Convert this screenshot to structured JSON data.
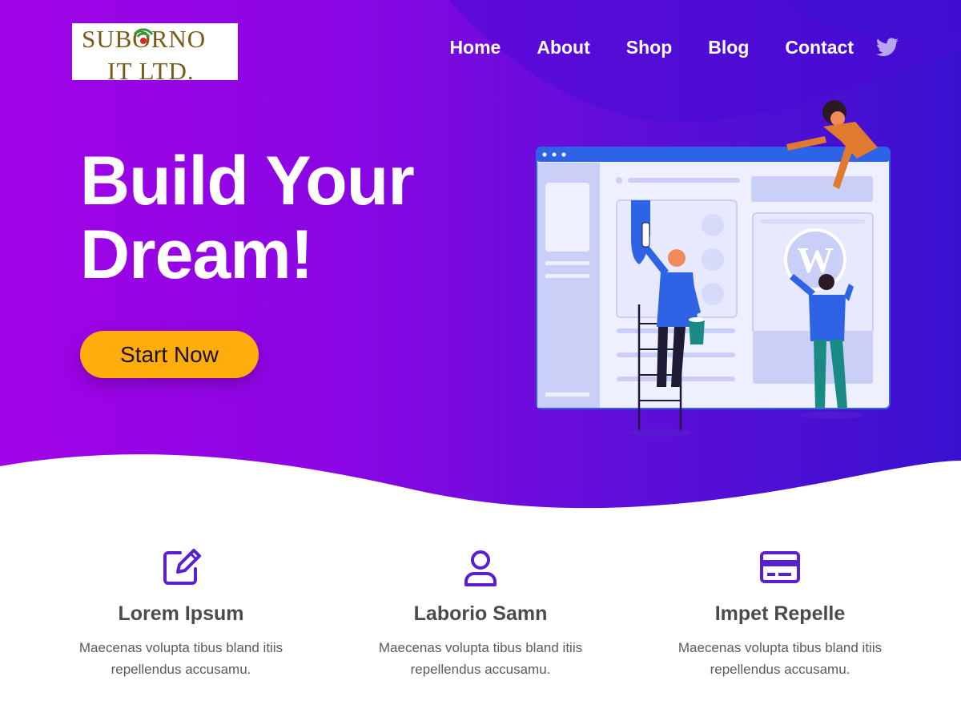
{
  "brand": {
    "logo_line1": "SUBORNO",
    "logo_line2": "IT LTD."
  },
  "nav": {
    "items": [
      {
        "label": "Home"
      },
      {
        "label": "About"
      },
      {
        "label": "Shop"
      },
      {
        "label": "Blog"
      },
      {
        "label": "Contact"
      }
    ],
    "social_icon": "twitter-icon"
  },
  "hero": {
    "headline_line1": "Build Your",
    "headline_line2": "Dream!",
    "cta_label": "Start Now",
    "illustration": "website-builders-illustration"
  },
  "features": [
    {
      "icon": "edit-icon",
      "title": "Lorem Ipsum",
      "text": "Maecenas volupta tibus bland itiis repellendus accusamu."
    },
    {
      "icon": "user-icon",
      "title": "Laborio Samn",
      "text": "Maecenas volupta tibus bland itiis repellendus accusamu."
    },
    {
      "icon": "credit-card-icon",
      "title": "Impet Repelle",
      "text": "Maecenas volupta tibus bland itiis repellendus accusamu."
    }
  ],
  "colors": {
    "hero_gradient_start": "#a103e6",
    "hero_gradient_end": "#3a10cf",
    "cta": "#ffad0b",
    "icon": "#5a1fd1",
    "text_dark": "#4b4b4b"
  }
}
